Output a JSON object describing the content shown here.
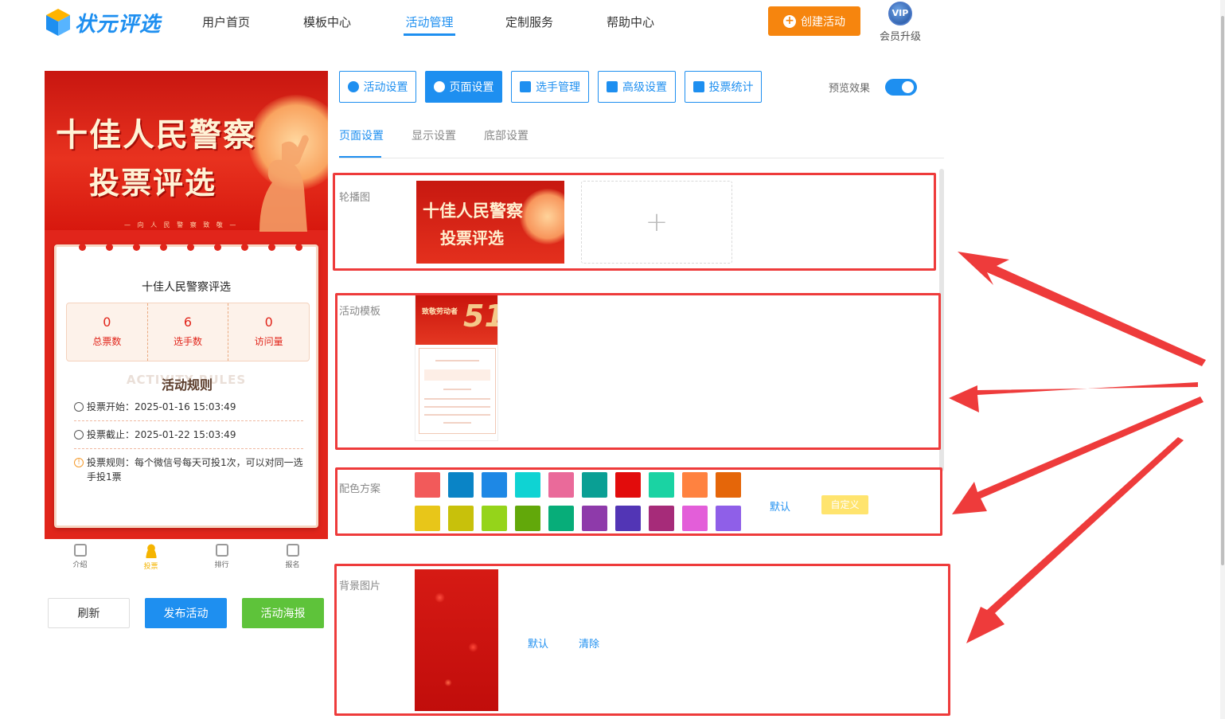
{
  "header": {
    "logo_text": "状元评选",
    "nav": [
      "用户首页",
      "模板中心",
      "活动管理",
      "定制服务",
      "帮助中心"
    ],
    "active_nav": "活动管理",
    "create_button": "创建活动",
    "vip_badge": "VIP",
    "vip_label": "会员升级"
  },
  "preview": {
    "banner_line1": "十佳人民警察",
    "banner_line2": "投票评选",
    "banner_sub": "— 向 人 民 警 察 致 敬 —",
    "card_title": "十佳人民警察评选",
    "stats": [
      {
        "value": "0",
        "label": "总票数"
      },
      {
        "value": "6",
        "label": "选手数"
      },
      {
        "value": "0",
        "label": "访问量"
      }
    ],
    "rules_bg": "ACTIVITY RULES",
    "rules_title": "活动规则",
    "vote_start": "投票开始：2025-01-16 15:03:49",
    "vote_end": "投票截止：2025-01-22 15:03:49",
    "vote_rule": "投票规则：每个微信号每天可投1次，可以对同一选手投1票",
    "tabs": [
      "介绍",
      "投票",
      "排行",
      "报名"
    ],
    "active_tab": "投票"
  },
  "actions": {
    "refresh": "刷新",
    "publish": "发布活动",
    "poster": "活动海报"
  },
  "toolbar": {
    "buttons": [
      "活动设置",
      "页面设置",
      "选手管理",
      "高级设置",
      "投票统计"
    ],
    "active": "页面设置",
    "preview_label": "预览效果",
    "preview_on": true
  },
  "subtabs": [
    "页面设置",
    "显示设置",
    "底部设置"
  ],
  "active_subtab": "页面设置",
  "sections": {
    "carousel_label": "轮播图",
    "carousel_thumb_line1": "十佳人民警察",
    "carousel_thumb_line2": "投票评选",
    "upload_icon": "+",
    "template_label": "活动模板",
    "template_title": "致敬劳动者",
    "template_number": "51",
    "color_label": "配色方案",
    "colors": [
      "#f25a5a",
      "#0a84c6",
      "#1e88e5",
      "#0fd3d3",
      "#ea6a9a",
      "#0a9f94",
      "#e20c0c",
      "#1ad3a3",
      "#ff8240",
      "#e56609",
      "#e8c619",
      "#c8c10b",
      "#95d41a",
      "#62a80a",
      "#07ad79",
      "#8e3aaa",
      "#5235b5",
      "#a62b79",
      "#e35ed9",
      "#8f5fe8"
    ],
    "color_default": "默认",
    "color_custom": "自定义",
    "bg_label": "背景图片",
    "bg_default": "默认",
    "bg_clear": "清除"
  }
}
